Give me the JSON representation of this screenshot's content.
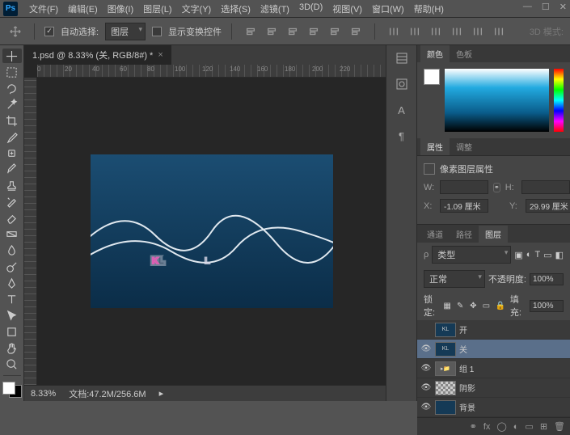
{
  "menu": [
    "文件(F)",
    "编辑(E)",
    "图像(I)",
    "图层(L)",
    "文字(Y)",
    "选择(S)",
    "滤镜(T)",
    "3D(D)",
    "视图(V)",
    "窗口(W)",
    "帮助(H)"
  ],
  "options": {
    "auto_select_label": "自动选择:",
    "auto_select_target": "图层",
    "show_transform": "显示变换控件",
    "mode_3d_label": "3D 模式:"
  },
  "doc": {
    "tab_title": "1.psd @ 8.33% (关, RGB/8#) *"
  },
  "ruler": [
    "0",
    "20",
    "40",
    "60",
    "80",
    "100",
    "120",
    "140",
    "160",
    "180",
    "200",
    "220"
  ],
  "status": {
    "zoom": "8.33%",
    "filesize": "文档:47.2M/256.6M"
  },
  "color_tabs": [
    "颜色",
    "色板"
  ],
  "prop_tabs": [
    "属性",
    "调整"
  ],
  "properties": {
    "title": "像素图层属性",
    "w_label": "W:",
    "w": "",
    "h_label": "H:",
    "h": "",
    "x_label": "X:",
    "x": "-1.09 厘米",
    "y_label": "Y:",
    "y": "29.99 厘米"
  },
  "layer_tabs": [
    "通道",
    "路径",
    "图层"
  ],
  "layers_panel": {
    "kind": "类型",
    "blend": "正常",
    "opacity_label": "不透明度:",
    "opacity": "100%",
    "lock_label": "锁定:",
    "fill_label": "填充:",
    "fill": "100%"
  },
  "layers": [
    {
      "name": "开",
      "vis": false,
      "thumb": "kl"
    },
    {
      "name": "关",
      "vis": true,
      "thumb": "kl",
      "active": true
    },
    {
      "name": "组 1",
      "vis": true,
      "thumb": "folder"
    },
    {
      "name": "阴影",
      "vis": true,
      "thumb": "checker"
    },
    {
      "name": "背景",
      "vis": true,
      "thumb": "bg"
    }
  ],
  "canvas_text": "KL"
}
